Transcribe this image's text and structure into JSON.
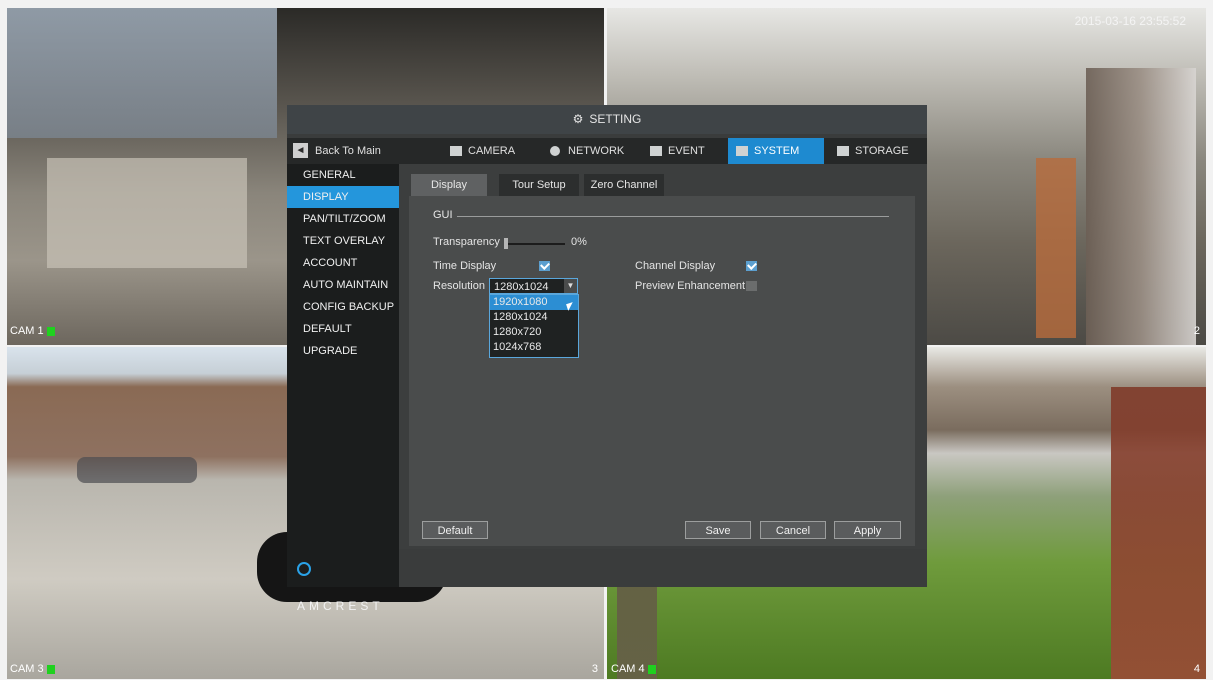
{
  "timestamp": "2015-03-16 23:55:52",
  "cameras": [
    {
      "label": "CAM 1",
      "num": ""
    },
    {
      "label": "",
      "num": "2"
    },
    {
      "label": "CAM 3",
      "num": "3"
    },
    {
      "label": "CAM 4",
      "num": "4"
    }
  ],
  "dialog": {
    "title": "SETTING",
    "back_label": "Back To Main",
    "tabs": [
      "CAMERA",
      "NETWORK",
      "EVENT",
      "SYSTEM",
      "STORAGE"
    ],
    "active_tab": "SYSTEM",
    "sidebar": [
      "GENERAL",
      "DISPLAY",
      "PAN/TILT/ZOOM",
      "TEXT OVERLAY",
      "ACCOUNT",
      "AUTO MAINTAIN",
      "CONFIG BACKUP",
      "DEFAULT",
      "UPGRADE"
    ],
    "active_sidebar": "DISPLAY",
    "logo": "AMCREST",
    "subtabs": [
      "Display",
      "Tour Setup",
      "Zero Channel"
    ],
    "active_subtab": "Display",
    "gui": {
      "section_label": "GUI",
      "transparency_label": "Transparency",
      "transparency_value": "0%",
      "time_display_label": "Time Display",
      "time_display_checked": true,
      "channel_display_label": "Channel Display",
      "channel_display_checked": true,
      "resolution_label": "Resolution",
      "resolution_value": "1280x1024",
      "resolution_options": [
        "1920x1080",
        "1280x1024",
        "1280x720",
        "1024x768"
      ],
      "highlighted_option": "1920x1080",
      "preview_enhancement_label": "Preview Enhancement",
      "preview_enhancement_checked": false
    },
    "buttons": {
      "default": "Default",
      "save": "Save",
      "cancel": "Cancel",
      "apply": "Apply"
    }
  },
  "colors": {
    "accent": "#2496dc",
    "dialog_bg": "#3a3c3c",
    "rec_indicator": "#1fd11f"
  }
}
